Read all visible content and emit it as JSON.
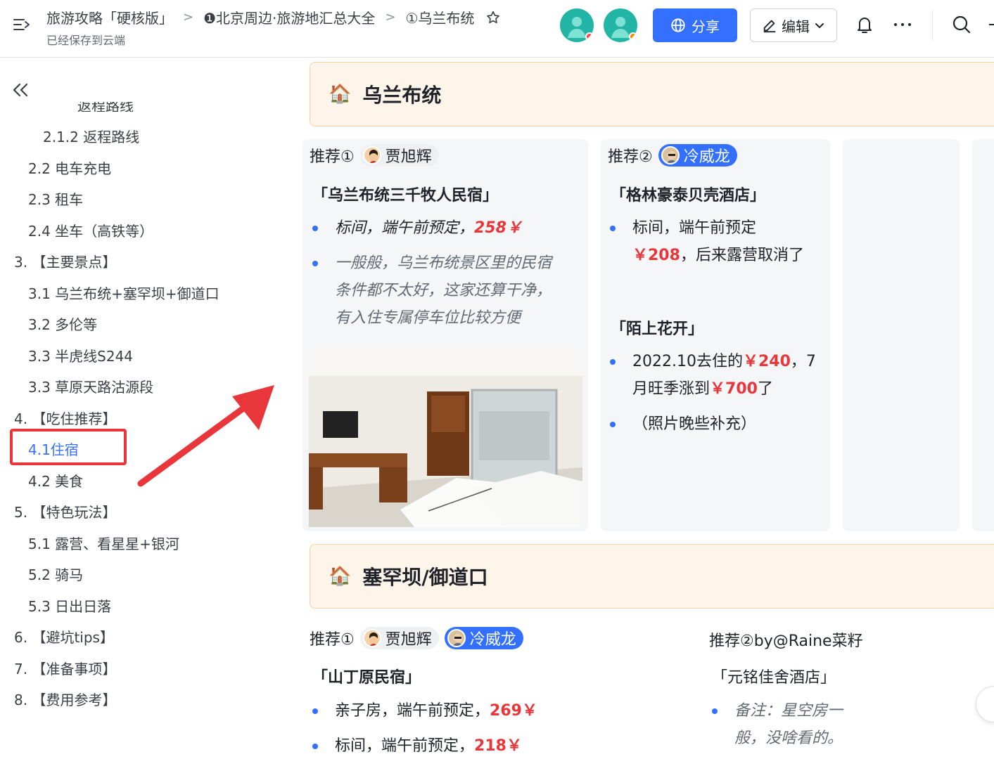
{
  "header": {
    "breadcrumb": [
      "旅游攻略「硬核版」",
      "❶北京周边·旅游地汇总大全",
      "①乌兰布统"
    ],
    "saved_status": "已经保存到云端",
    "share_label": "分享",
    "edit_label": "编辑",
    "colors": {
      "primary": "#3370ff",
      "avatar": "#22b5a5"
    }
  },
  "toc": {
    "partial_item": "返程路线",
    "items": [
      "2.1.2 返程路线",
      "2.2 电车充电",
      "2.3 租车",
      "2.4 坐车（高铁等）",
      "3. 【主要景点】",
      "3.1 乌兰布统+塞罕坝+御道口",
      "3.2 多伦等",
      "3.3 半虎线S244",
      "3.3 草原天路沽源段",
      "4. 【吃住推荐】",
      "4.1住宿",
      "4.2 美食",
      "5. 【特色玩法】",
      "5.1 露营、看星星+银河",
      "5.2 骑马",
      "5.3 日出日落",
      "6. 【避坑tips】",
      "7. 【准备事项】",
      "8. 【费用参考】"
    ],
    "active_index": 10
  },
  "section1": {
    "title": "乌兰布统",
    "emoji": "🏠",
    "col1": {
      "rec_label": "推荐①",
      "mention": "贾旭辉",
      "hotel": "「乌兰布统三千牧人民宿」",
      "b1_text": "标间，端午前预定，",
      "b1_price": "258￥",
      "b2_l1": "一般般，乌兰布统景区里的民宿",
      "b2_l2": "条件都不太好，这家还算干净，",
      "b2_l3": "有入住专属停车位比较方便"
    },
    "col2": {
      "rec_label": "推荐②",
      "mention": "冷威龙",
      "hotel1": "「格林豪泰贝壳酒店」",
      "h1_b1_l1": "标间，端午前预定",
      "h1_b1_price": "￥208",
      "h1_b1_l2": "，后来露营取消了",
      "hotel2": "「陌上花开」",
      "h2_b1_a": "2022.10去住的",
      "h2_b1_price1": "￥240",
      "h2_b1_b": "，7",
      "h2_b1_c": "月旺季涨到",
      "h2_b1_price2": "￥700",
      "h2_b1_d": "了",
      "h2_b2": "（照片晚些补充）"
    }
  },
  "section2": {
    "title": "塞罕坝/御道口",
    "emoji": "🏠",
    "left": {
      "rec_label": "推荐①",
      "mention1": "贾旭辉",
      "mention2": "冷威龙",
      "hotel": "「山丁原民宿」",
      "b1_text": "亲子房，端午前预定，",
      "b1_price": "269￥",
      "b2_text": "标间，端午前预定，",
      "b2_price": "218￥"
    },
    "right": {
      "rec_label": "推荐②by@Raine菜籽",
      "hotel": "「元铭佳舍酒店」",
      "b1_l1": "备注：星空房一",
      "b1_l2": "般，没啥看的。"
    }
  }
}
